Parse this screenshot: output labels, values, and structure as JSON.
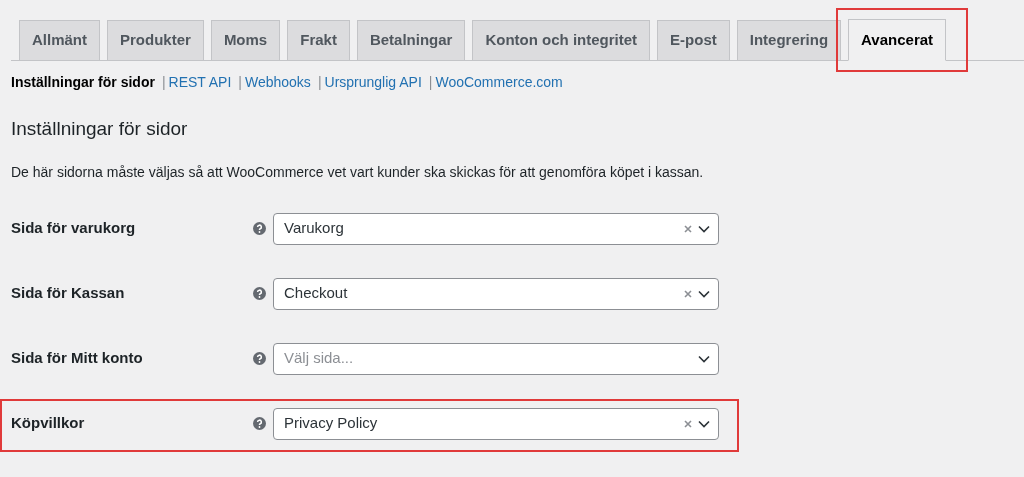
{
  "tabs": [
    {
      "label": "Allmänt",
      "selected": false,
      "highlighted": false
    },
    {
      "label": "Produkter",
      "selected": false,
      "highlighted": false
    },
    {
      "label": "Moms",
      "selected": false,
      "highlighted": false
    },
    {
      "label": "Frakt",
      "selected": false,
      "highlighted": false
    },
    {
      "label": "Betalningar",
      "selected": false,
      "highlighted": false
    },
    {
      "label": "Konton och integritet",
      "selected": false,
      "highlighted": false
    },
    {
      "label": "E-post",
      "selected": false,
      "highlighted": false
    },
    {
      "label": "Integrering",
      "selected": false,
      "highlighted": false
    },
    {
      "label": "Avancerat",
      "selected": true,
      "highlighted": true
    }
  ],
  "subnav": {
    "separator": "|",
    "items": [
      {
        "label": "Inställningar för sidor",
        "selected": true
      },
      {
        "label": "REST API",
        "selected": false
      },
      {
        "label": "Webhooks",
        "selected": false
      },
      {
        "label": "Ursprunglig API",
        "selected": false
      },
      {
        "label": "WooCommerce.com",
        "selected": false
      }
    ]
  },
  "heading": "Inställningar för sidor",
  "description": "De här sidorna måste väljas så att WooCommerce vet vart kunder ska skickas för att genomföra köpet i kassan.",
  "settings": [
    {
      "label": "Sida för varukorg",
      "value": "Varukorg",
      "clearable": true,
      "highlighted": false
    },
    {
      "label": "Sida för Kassan",
      "value": "Checkout",
      "clearable": true,
      "highlighted": false
    },
    {
      "label": "Sida för Mitt konto",
      "placeholder": "Välj sida...",
      "clearable": false,
      "highlighted": false
    },
    {
      "label": "Köpvillkor",
      "value": "Privacy Policy",
      "clearable": true,
      "highlighted": true
    }
  ]
}
